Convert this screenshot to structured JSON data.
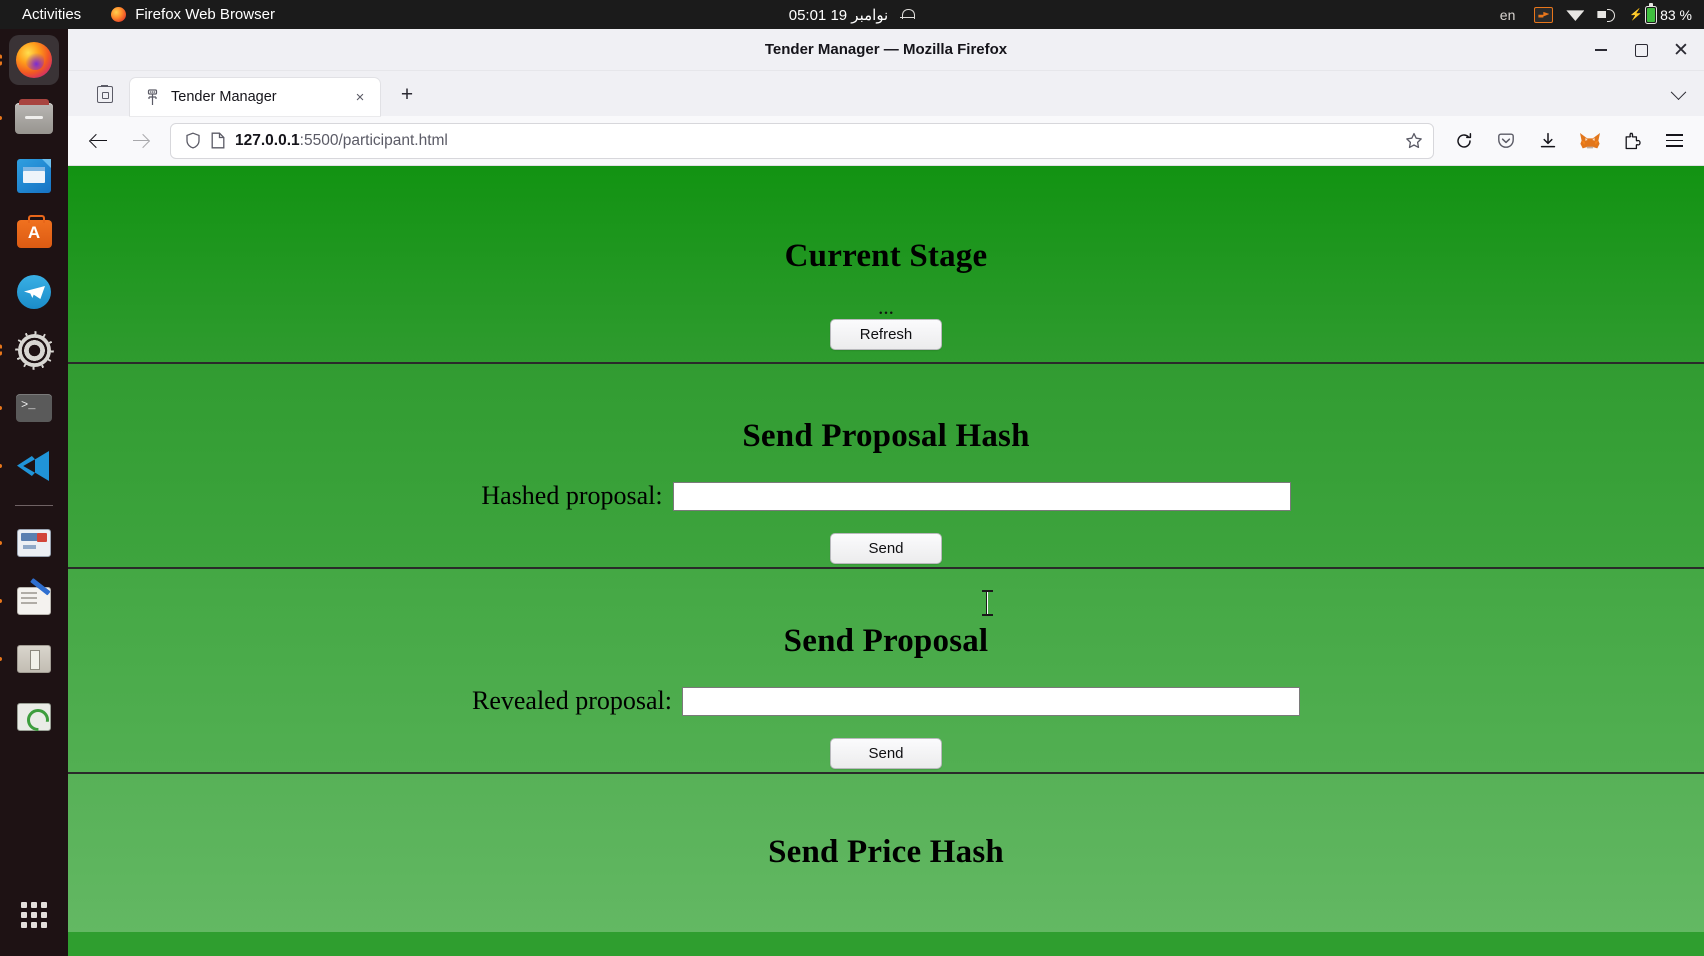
{
  "topbar": {
    "activities": "Activities",
    "app_name": "Firefox Web Browser",
    "clock": "05:01  نوامبر 19",
    "keyboard_language": "en",
    "battery_percent": "83 %",
    "icons": {
      "firefox": "firefox-icon",
      "bell": "notifications-bell-icon",
      "screen_share": "screen-share-icon",
      "wifi": "wifi-icon",
      "volume": "volume-icon",
      "battery": "battery-icon"
    }
  },
  "dock": {
    "items": [
      {
        "name": "firefox",
        "label": "Firefox Web Browser"
      },
      {
        "name": "files",
        "label": "Files"
      },
      {
        "name": "libreoffice-impress",
        "label": "LibreOffice Impress"
      },
      {
        "name": "ubuntu-software",
        "label": "Ubuntu Software"
      },
      {
        "name": "telegram",
        "label": "Telegram"
      },
      {
        "name": "settings",
        "label": "Settings"
      },
      {
        "name": "terminal",
        "label": "Terminal"
      },
      {
        "name": "vscode",
        "label": "Visual Studio Code"
      },
      {
        "name": "dictionary",
        "label": "Dictionary"
      },
      {
        "name": "text-editor",
        "label": "Text Editor"
      },
      {
        "name": "archive-manager",
        "label": "Archive Manager"
      },
      {
        "name": "disk-utility",
        "label": "Disk Utility"
      }
    ],
    "show_applications": "Show Applications"
  },
  "window": {
    "title": "Tender Manager — Mozilla Firefox",
    "controls": {
      "minimize": "minimize",
      "maximize": "maximize",
      "close": "close"
    }
  },
  "browser": {
    "tab": {
      "title": "Tender Manager",
      "close_label": "×"
    },
    "new_tab_label": "+",
    "url": {
      "host": "127.0.0.1",
      "path": ":5500/participant.html",
      "full": "127.0.0.1:5500/participant.html"
    },
    "toolbar_icons": [
      "back-icon",
      "forward-icon",
      "shield-icon",
      "page-icon",
      "star-icon",
      "reload-icon",
      "pocket-icon",
      "download-icon",
      "metamask-icon",
      "extensions-icon",
      "menu-icon"
    ]
  },
  "page": {
    "sections": [
      {
        "id": "current-stage",
        "heading": "Current Stage",
        "stage_value": "...",
        "button": "Refresh"
      },
      {
        "id": "send-proposal-hash",
        "heading": "Send Proposal Hash",
        "field_label": "Hashed proposal:",
        "field_value": "",
        "button": "Send"
      },
      {
        "id": "send-proposal",
        "heading": "Send Proposal",
        "field_label": "Revealed proposal:",
        "field_value": "",
        "button": "Send"
      },
      {
        "id": "send-price-hash",
        "heading": "Send Price Hash"
      }
    ]
  },
  "colors": {
    "stage_green_top": "#129312",
    "hash_green": "#319c31",
    "proposal_green": "#44a844",
    "price_green": "#57b157",
    "accent_orange": "#e8761b"
  }
}
